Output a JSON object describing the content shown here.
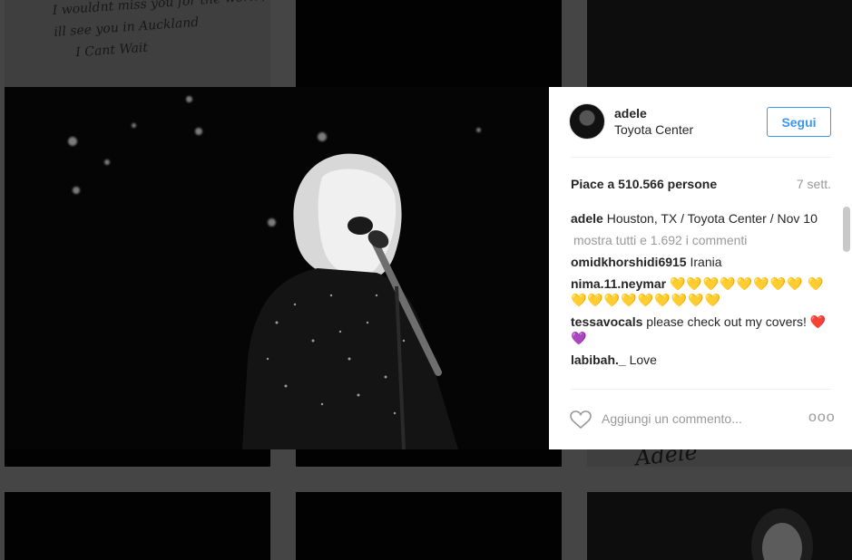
{
  "background": {
    "handwriting_lines": [
      "I wouldnt miss you for the world,",
      "ill see you in Auckland",
      "I Cant Wait"
    ],
    "signature": "Adele"
  },
  "post": {
    "username": "adele",
    "location": "Toyota Center",
    "follow_label": "Segui",
    "likes": "Piace a 510.566 persone",
    "age": "7 sett.",
    "caption_user": "adele",
    "caption_text": "Houston, TX / Toyota Center / Nov 10",
    "view_all": "mostra tutti e 1.692 i commenti",
    "comments": [
      {
        "user": "omidkhorshidi6915",
        "text": "Irania"
      },
      {
        "user": "nima.11.neymar",
        "text": "💛💛💛💛💛💛💛💛 💛💛💛💛💛💛💛💛💛💛"
      },
      {
        "user": "tessavocals",
        "text": "please check out my covers! ❤️💜"
      },
      {
        "user": "labibah._",
        "text": "Love"
      }
    ],
    "comment_placeholder": "Aggiungi un commento...",
    "more_label": "ooo"
  },
  "icons": {
    "heart": "heart-icon",
    "more": "more-options-icon"
  },
  "colors": {
    "accent": "#3897f0",
    "muted": "#999999",
    "text": "#262626"
  }
}
